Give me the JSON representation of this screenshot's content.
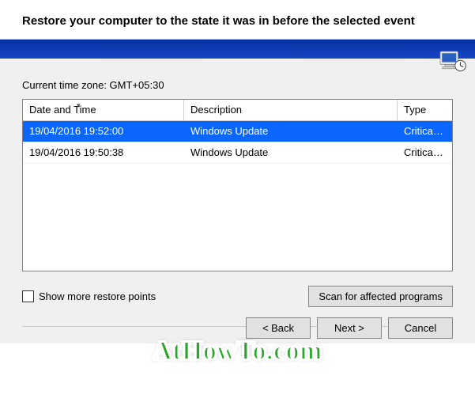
{
  "header": {
    "title": "Restore your computer to the state it was in before the selected event"
  },
  "timezone_label": "Current time zone: GMT+05:30",
  "table": {
    "columns": {
      "date": "Date and Time",
      "desc": "Description",
      "type": "Type"
    },
    "rows": [
      {
        "date": "19/04/2016 19:52:00",
        "desc": "Windows Update",
        "type": "Critical Update",
        "selected": true
      },
      {
        "date": "19/04/2016 19:50:38",
        "desc": "Windows Update",
        "type": "Critical Update",
        "selected": false
      }
    ]
  },
  "checkbox": {
    "label": "Show more restore points",
    "checked": false
  },
  "buttons": {
    "scan": "Scan for affected programs",
    "back": "< Back",
    "next": "Next >",
    "cancel": "Cancel"
  },
  "watermark": "AtHowTo.com"
}
